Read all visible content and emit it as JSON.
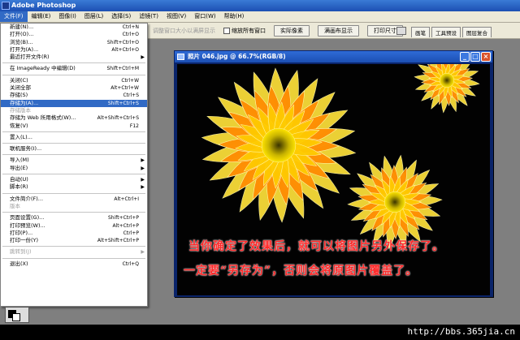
{
  "app": {
    "title": "Adobe Photoshop"
  },
  "menubar": [
    {
      "label": "文件(F)",
      "active": true
    },
    {
      "label": "编辑(E)"
    },
    {
      "label": "图像(I)"
    },
    {
      "label": "图层(L)"
    },
    {
      "label": "选择(S)"
    },
    {
      "label": "滤镜(T)"
    },
    {
      "label": "视图(V)"
    },
    {
      "label": "窗口(W)"
    },
    {
      "label": "帮助(H)"
    }
  ],
  "options": {
    "faded_label": "调整窗口大小以满屏显示",
    "checkbox_label": "缩放所有窗口",
    "btn_actual": "实际像素",
    "btn_fit": "满画布显示",
    "btn_print": "打印尺寸"
  },
  "palette_tabs": [
    "画笔",
    "工具预设",
    "图层复合"
  ],
  "file_menu": [
    {
      "label": "新建(N)...",
      "shortcut": "Ctrl+N"
    },
    {
      "label": "打开(O)...",
      "shortcut": "Ctrl+O"
    },
    {
      "label": "浏览(B)...",
      "shortcut": "Shift+Ctrl+O"
    },
    {
      "label": "打开为(A)...",
      "shortcut": "Alt+Ctrl+O"
    },
    {
      "label": "最近打开文件(R)",
      "submenu": true
    },
    {
      "sep": true
    },
    {
      "label": "在 ImageReady 中编辑(D)",
      "shortcut": "Shift+Ctrl+M"
    },
    {
      "sep": true
    },
    {
      "label": "关闭(C)",
      "shortcut": "Ctrl+W"
    },
    {
      "label": "关闭全部",
      "shortcut": "Alt+Ctrl+W"
    },
    {
      "label": "存储(S)",
      "shortcut": "Ctrl+S"
    },
    {
      "label": "存储为(A)...",
      "shortcut": "Shift+Ctrl+S",
      "highlight": true
    },
    {
      "label": "存储版本",
      "disabled": true
    },
    {
      "label": "存储为 Web 所用格式(W)...",
      "shortcut": "Alt+Shift+Ctrl+S"
    },
    {
      "label": "恢复(V)",
      "shortcut": "F12"
    },
    {
      "sep": true
    },
    {
      "label": "置入(L)..."
    },
    {
      "sep": true
    },
    {
      "label": "联机服务(I)..."
    },
    {
      "sep": true
    },
    {
      "label": "导入(M)",
      "submenu": true
    },
    {
      "label": "导出(E)",
      "submenu": true
    },
    {
      "sep": true
    },
    {
      "label": "自动(U)",
      "submenu": true
    },
    {
      "label": "脚本(R)",
      "submenu": true
    },
    {
      "sep": true
    },
    {
      "label": "文件简介(F)...",
      "shortcut": "Alt+Ctrl+I"
    },
    {
      "label": "版本",
      "disabled": true
    },
    {
      "sep": true
    },
    {
      "label": "页面设置(G)...",
      "shortcut": "Shift+Ctrl+P"
    },
    {
      "label": "打印预览(W)...",
      "shortcut": "Alt+Ctrl+P"
    },
    {
      "label": "打印(P)...",
      "shortcut": "Ctrl+P"
    },
    {
      "label": "打印一份(Y)",
      "shortcut": "Alt+Shift+Ctrl+P"
    },
    {
      "sep": true
    },
    {
      "label": "跳转到(J)",
      "submenu": true,
      "disabled": true
    },
    {
      "sep": true
    },
    {
      "label": "退出(X)",
      "shortcut": "Ctrl+Q"
    }
  ],
  "document": {
    "title": "照片 046.jpg @ 66.7%(RGB/8)",
    "caption_line1": "当你确定了效果后，就可以将图片另外保存了。",
    "caption_line2": "一定要“另存为”，否则会将原图片覆盖了。"
  },
  "watermark": "http://bbs.365jia.cn",
  "colors": {
    "title_blue": "#1c4fb3",
    "menu_highlight": "#316ac5",
    "caption_red": "#ff2a2a"
  }
}
